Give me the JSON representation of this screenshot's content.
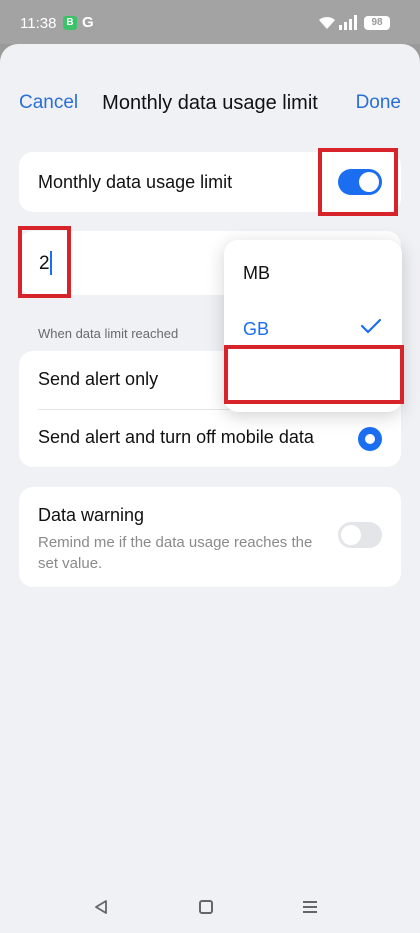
{
  "status_bar": {
    "time": "11:38",
    "app_badge_icon": "sim-icon",
    "app_badge_text": "B",
    "g_label": "G",
    "battery": "98"
  },
  "header": {
    "cancel_label": "Cancel",
    "title": "Monthly data usage limit",
    "done_label": "Done"
  },
  "limit_toggle": {
    "label": "Monthly data usage limit",
    "enabled": true
  },
  "limit_input": {
    "value": "2",
    "unit": "GB"
  },
  "when_reached": {
    "section_label": "When data limit reached",
    "options": [
      {
        "label": "Send alert only",
        "selected": false
      },
      {
        "label": "Send alert and turn off mobile data",
        "selected": true
      }
    ]
  },
  "data_warning": {
    "label": "Data warning",
    "description": "Remind me if the data usage reaches the set value.",
    "enabled": false
  },
  "unit_menu": {
    "options": [
      {
        "label": "MB",
        "selected": false
      },
      {
        "label": "GB",
        "selected": true
      }
    ]
  },
  "colors": {
    "accent": "#1b6ef0",
    "highlight": "#d7242b"
  }
}
